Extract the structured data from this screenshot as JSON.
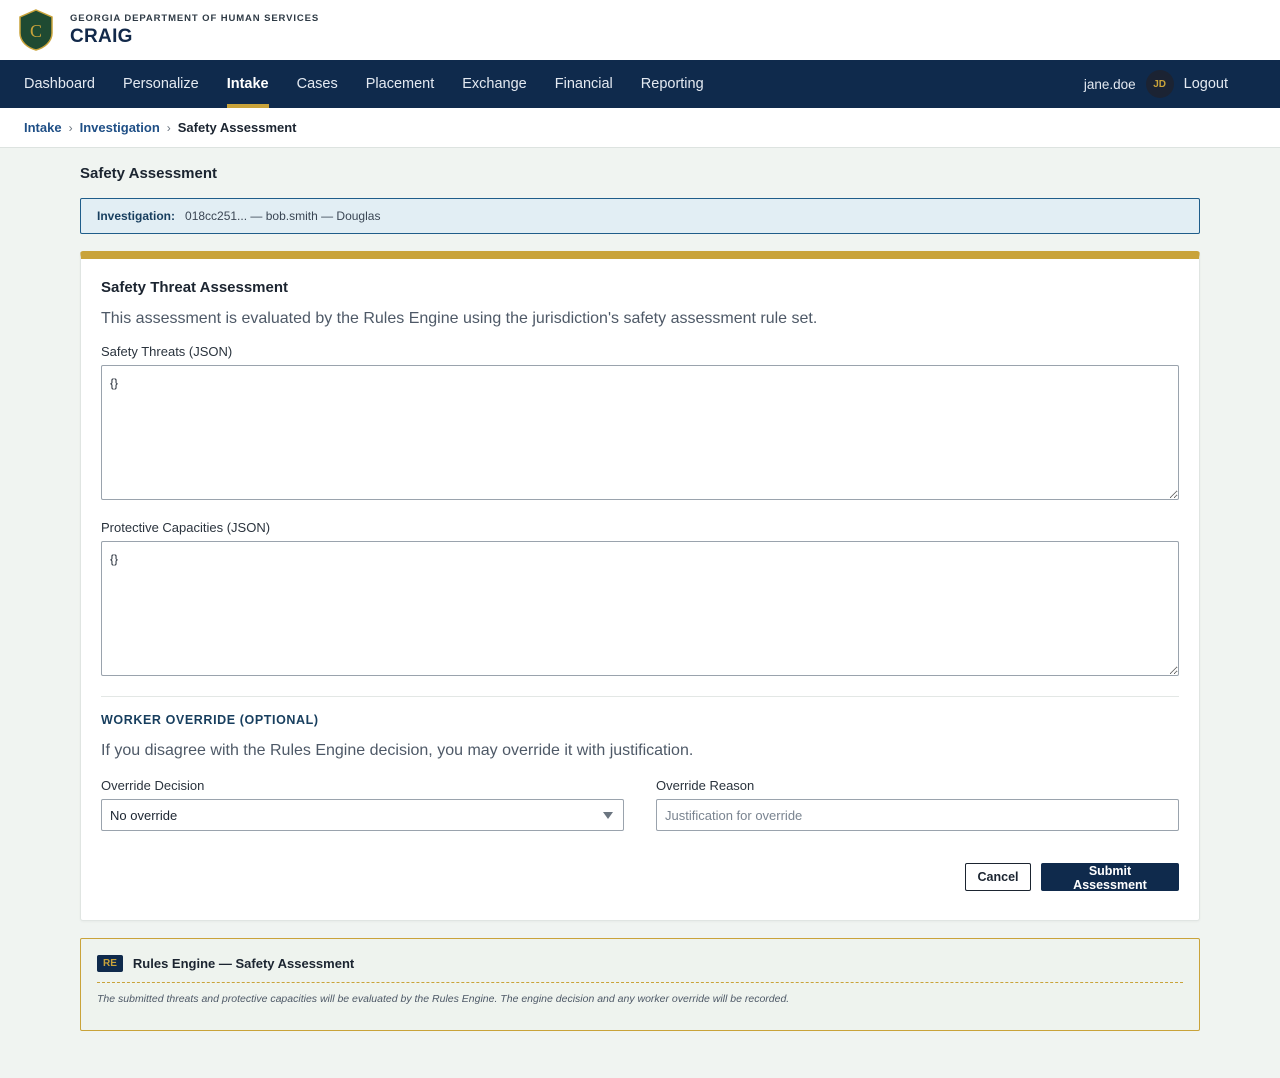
{
  "header": {
    "department": "GEORGIA DEPARTMENT OF HUMAN SERVICES",
    "app_name": "CRAIG",
    "logo_letter": "C",
    "logo_icon": "shield-logo-icon"
  },
  "nav": {
    "items": [
      {
        "label": "Dashboard",
        "active": false
      },
      {
        "label": "Personalize",
        "active": false
      },
      {
        "label": "Intake",
        "active": true
      },
      {
        "label": "Cases",
        "active": false
      },
      {
        "label": "Placement",
        "active": false
      },
      {
        "label": "Exchange",
        "active": false
      },
      {
        "label": "Financial",
        "active": false
      },
      {
        "label": "Reporting",
        "active": false
      }
    ],
    "username": "jane.doe",
    "avatar_initials": "JD",
    "logout_label": "Logout"
  },
  "breadcrumb": {
    "items": [
      "Intake",
      "Investigation"
    ],
    "separator": "›",
    "current": "Safety Assessment"
  },
  "page": {
    "title": "Safety Assessment",
    "investigation_label": "Investigation:",
    "investigation_value": "018cc251... — bob.smith — Douglas"
  },
  "form": {
    "card_title": "Safety Threat Assessment",
    "description": "This assessment is evaluated by the Rules Engine using the jurisdiction's safety assessment rule set.",
    "threats_label": "Safety Threats (JSON)",
    "threats_value": "{}",
    "capacities_label": "Protective Capacities (JSON)",
    "capacities_value": "{}",
    "override_section_title": "WORKER OVERRIDE (OPTIONAL)",
    "override_description": "If you disagree with the Rules Engine decision, you may override it with justification.",
    "override_decision_label": "Override Decision",
    "override_decision_value": "No override",
    "override_reason_label": "Override Reason",
    "override_reason_placeholder": "Justification for override",
    "cancel_label": "Cancel",
    "submit_label": "Submit Assessment"
  },
  "rules_engine": {
    "badge": "RE",
    "title": "Rules Engine — Safety Assessment",
    "note": "The submitted threats and protective capacities will be evaluated by the Rules Engine. The engine decision and any worker override will be recorded."
  },
  "colors": {
    "navy": "#0f2a4c",
    "gold": "#c9a33a",
    "page_bg": "#f0f4f1",
    "info_bg": "#e2eef4"
  }
}
